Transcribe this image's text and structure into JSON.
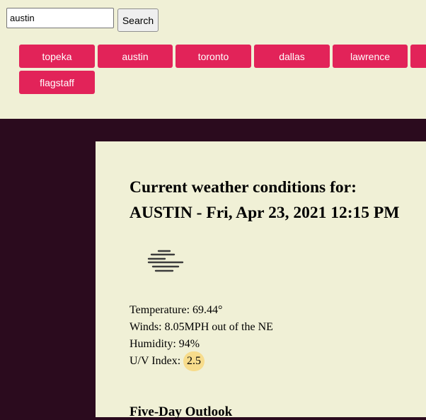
{
  "search": {
    "value": "austin",
    "button_label": "Search"
  },
  "history": {
    "cities": [
      "topeka",
      "austin",
      "toronto",
      "dallas",
      "lawrence",
      "flagstaff"
    ],
    "accent_color": "#e22359"
  },
  "current": {
    "heading_line1": "Current weather conditions for:",
    "heading_line2": "AUSTIN - Fri, Apr 23, 2021 12:15 PM",
    "icon": "fog-icon",
    "temperature": "Temperature: 69.44°",
    "winds": "Winds: 8.05MPH out of the NE",
    "humidity": "Humidity: 94%",
    "uv_label": "U/V Index:",
    "uv_value": "2.5",
    "uv_color": "#f7dc8c"
  },
  "outlook": {
    "title": "Five-Day Outlook"
  }
}
